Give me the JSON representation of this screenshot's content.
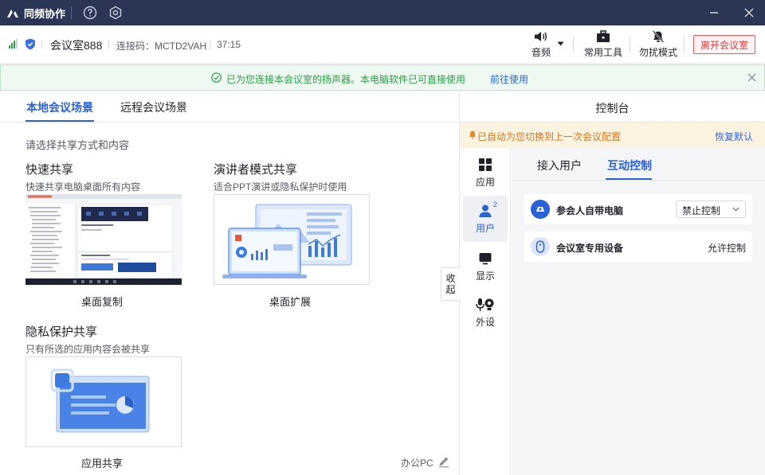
{
  "titlebar": {
    "app_name": "同频协作"
  },
  "infobar": {
    "room_name": "会议室888",
    "connection_code": "连接码：MCTD2VAH",
    "elapsed": "37:15",
    "tools": {
      "audio": "音频",
      "tools": "常用工具",
      "dnd": "勿扰模式"
    },
    "leave_button": "离开会议室"
  },
  "notice": {
    "message": "已为您连接本会议室的扬声器。本电脑软件已可直接使用",
    "link": "前往使用"
  },
  "left": {
    "tabs": [
      "本地会议场景",
      "远程会议场景"
    ],
    "hint": "请选择共享方式和内容",
    "sections": {
      "quick": {
        "title": "快速共享",
        "subtitle": "快速共享电脑桌面所有内容",
        "card": "桌面复制"
      },
      "presenter": {
        "title": "演讲者模式共享",
        "subtitle": "适合PPT演讲或隐私保护时使用",
        "card": "桌面扩展"
      },
      "privacy": {
        "title": "隐私保护共享",
        "subtitle": "只有所选的应用内容会被共享",
        "card": "应用共享"
      }
    },
    "device_name": "办公PC",
    "collapse": [
      "收",
      "起"
    ]
  },
  "right": {
    "title": "控制台",
    "auto_notice": "已自动为您切换到上一次会议配置",
    "restore": "恢复默认",
    "side": [
      {
        "label": "应用",
        "icon": "apps-icon"
      },
      {
        "label": "用户",
        "icon": "user-icon",
        "badge": "2"
      },
      {
        "label": "显示",
        "icon": "display-icon"
      },
      {
        "label": "外设",
        "icon": "peripheral-icon"
      }
    ],
    "tabs": [
      "接入用户",
      "互动控制"
    ],
    "rows": [
      {
        "label": "参会人自带电脑",
        "value": "禁止控制"
      },
      {
        "label": "会议室专用设备",
        "value": "允许控制"
      }
    ]
  },
  "colors": {
    "accent": "#2b62d6",
    "titlebar": "#2b3556",
    "danger": "#e03b3b",
    "success": "#2f9b48"
  }
}
